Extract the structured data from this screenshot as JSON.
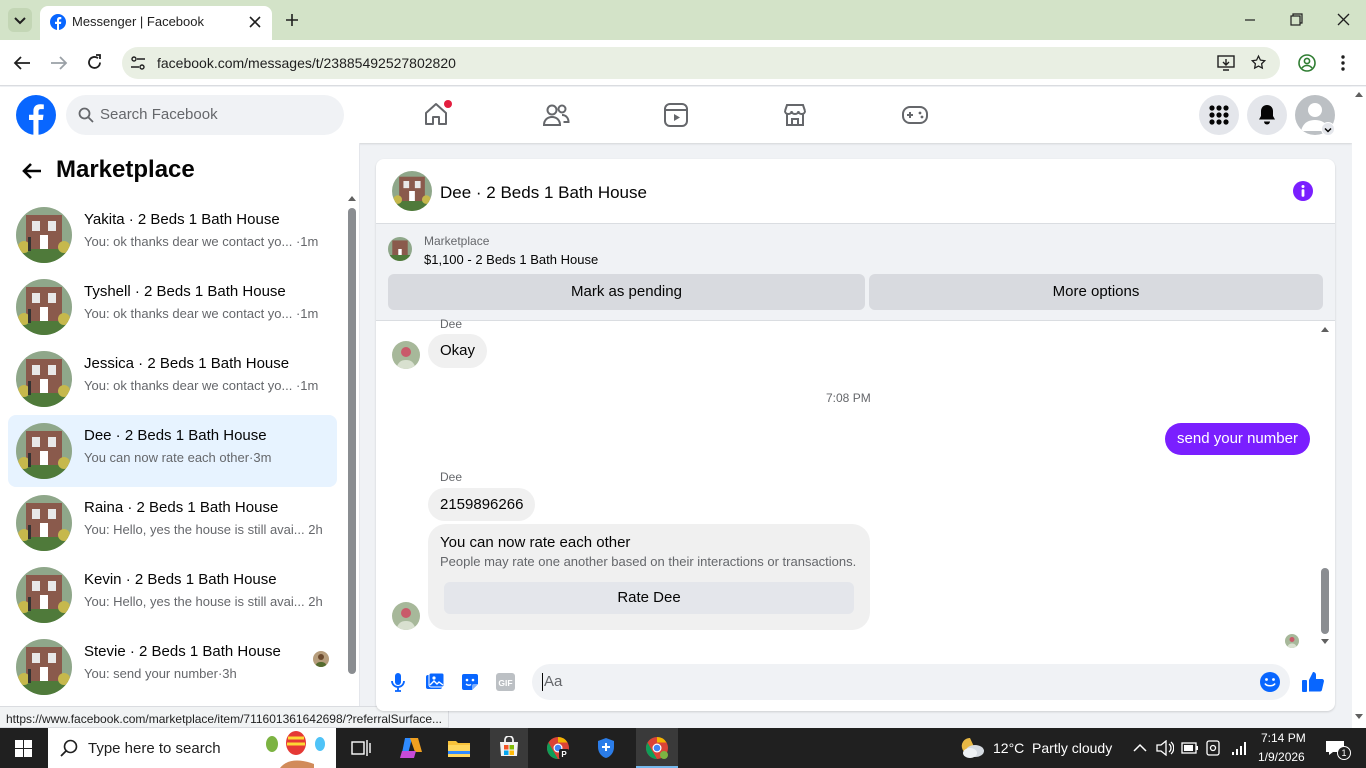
{
  "browser": {
    "tab_title": "Messenger | Facebook",
    "url": "facebook.com/messages/t/23885492527802820",
    "status_url": "https://www.facebook.com/marketplace/item/711601361642698/?referralSurface..."
  },
  "fb": {
    "search_placeholder": "Search Facebook"
  },
  "sidebar": {
    "title": "Marketplace",
    "conversations": [
      {
        "name": "Yakita · 2 Beds 1 Bath House",
        "preview": "You: ok thanks dear we contact yo... ·1m"
      },
      {
        "name": "Tyshell · 2 Beds 1 Bath House",
        "preview": "You: ok thanks dear we contact yo... ·1m"
      },
      {
        "name": "Jessica · 2 Beds 1 Bath House",
        "preview": "You: ok thanks dear we contact yo... ·1m"
      },
      {
        "name": "Dee · 2 Beds 1 Bath House",
        "preview": "You can now rate each other·3m"
      },
      {
        "name": "Raina · 2 Beds 1 Bath House",
        "preview": "You: Hello, yes the house is still avai... 2h"
      },
      {
        "name": "Kevin · 2 Beds 1 Bath House",
        "preview": "You: Hello, yes the house is still avai... 2h"
      },
      {
        "name": "Stevie · 2 Beds 1 Bath House",
        "preview": "You: send your number·3h"
      }
    ]
  },
  "chat": {
    "title": "Dee · 2 Beds 1 Bath House",
    "listing_label": "Marketplace",
    "listing_detail": "$1,100 - 2 Beds 1 Bath House",
    "mark_pending": "Mark as pending",
    "more_options": "More options",
    "messages": {
      "sender_1": "Dee",
      "msg_okay": "Okay",
      "timestamp": "7:08 PM",
      "msg_out": "send your number",
      "sender_2": "Dee",
      "msg_number": "2159896266",
      "rate_title": "You can now rate each other",
      "rate_desc": "People may rate one another based on their interactions or transactions.",
      "rate_button": "Rate Dee"
    },
    "composer_placeholder": "Aa"
  },
  "taskbar": {
    "search_placeholder": "Type here to search",
    "weather": "12°C  Partly cloudy",
    "time": "7:14 PM",
    "date": "1/9/2026",
    "notif_count": "1"
  },
  "colors": {
    "fb_blue": "#0866ff",
    "messenger_purple": "#7a1fff",
    "active_row": "#e7f3ff"
  }
}
